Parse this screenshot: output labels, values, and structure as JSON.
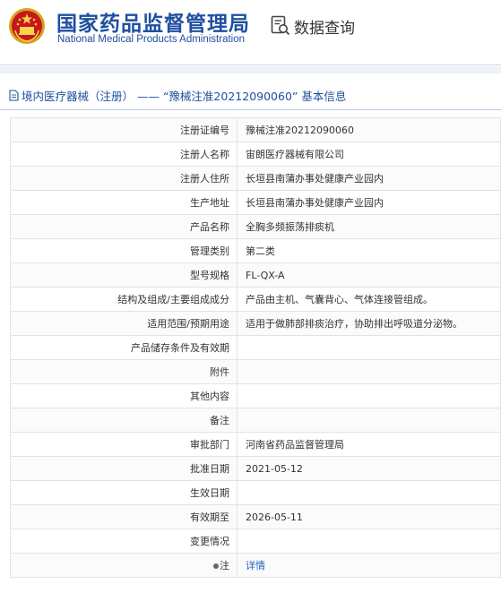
{
  "header": {
    "agency_cn": "国家药品监督管理局",
    "agency_en": "National Medical Products Administration",
    "search_label": "数据查询",
    "brand_color": "#1f4fa0"
  },
  "section": {
    "title": "境内医疗器械（注册） —— “豫械注准20212090060” 基本信息"
  },
  "rows": [
    {
      "label": "注册证编号",
      "value": "豫械注准20212090060"
    },
    {
      "label": "注册人名称",
      "value": "宙朗医疗器械有限公司"
    },
    {
      "label": "注册人住所",
      "value": "长垣县南蒲办事处健康产业园内"
    },
    {
      "label": "生产地址",
      "value": "长垣县南蒲办事处健康产业园内"
    },
    {
      "label": "产品名称",
      "value": "全胸多频振荡排痰机"
    },
    {
      "label": "管理类别",
      "value": "第二类"
    },
    {
      "label": "型号规格",
      "value": "FL-QX-A"
    },
    {
      "label": "结构及组成/主要组成成分",
      "value": "产品由主机、气囊背心、气体连接管组成。"
    },
    {
      "label": "适用范围/预期用途",
      "value": "适用于做肺部排痰治疗，协助排出呼吸道分泌物。"
    },
    {
      "label": "产品储存条件及有效期",
      "value": ""
    },
    {
      "label": "附件",
      "value": ""
    },
    {
      "label": "其他内容",
      "value": ""
    },
    {
      "label": "备注",
      "value": ""
    },
    {
      "label": "审批部门",
      "value": "河南省药品监督管理局"
    },
    {
      "label": "批准日期",
      "value": "2021-05-12"
    },
    {
      "label": "生效日期",
      "value": ""
    },
    {
      "label": "有效期至",
      "value": "2026-05-11"
    },
    {
      "label": "变更情况",
      "value": ""
    }
  ],
  "note": {
    "label": "注",
    "link": "详情"
  }
}
